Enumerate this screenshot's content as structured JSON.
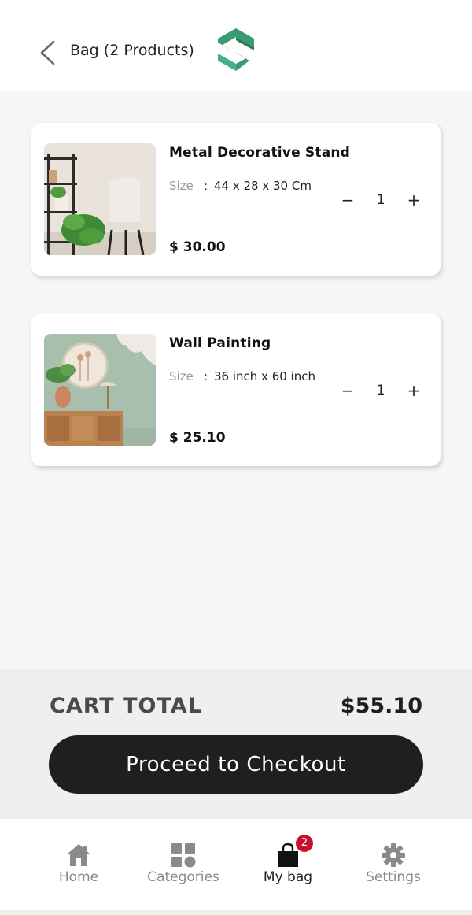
{
  "header": {
    "title": "Bag (2 Products)",
    "back_icon": "chevron-left-icon",
    "logo_icon": "brand-logo-icon",
    "brand_color": "#3a9a72"
  },
  "products": [
    {
      "name": "Metal Decorative Stand",
      "size_label": "Size",
      "size_separator": ":",
      "size_value": "44 x 28 x 30 Cm",
      "price": "$ 30.00",
      "quantity": "1",
      "minus_label": "−",
      "plus_label": "+"
    },
    {
      "name": "Wall Painting",
      "size_label": "Size",
      "size_separator": ":",
      "size_value": "36 inch x 60 inch",
      "price": "$ 25.10",
      "quantity": "1",
      "minus_label": "−",
      "plus_label": "+"
    }
  ],
  "cart": {
    "total_label": "CART TOTAL",
    "total_value": "$55.10",
    "checkout_label": "Proceed to Checkout"
  },
  "tabbar": {
    "items": [
      {
        "label": "Home",
        "icon": "home-icon"
      },
      {
        "label": "Categories",
        "icon": "grid-icon"
      },
      {
        "label": "My bag",
        "icon": "bag-icon"
      },
      {
        "label": "Settings",
        "icon": "gear-icon"
      }
    ],
    "active": "My bag",
    "bag_badge": "2",
    "badge_color": "#c8102e"
  }
}
